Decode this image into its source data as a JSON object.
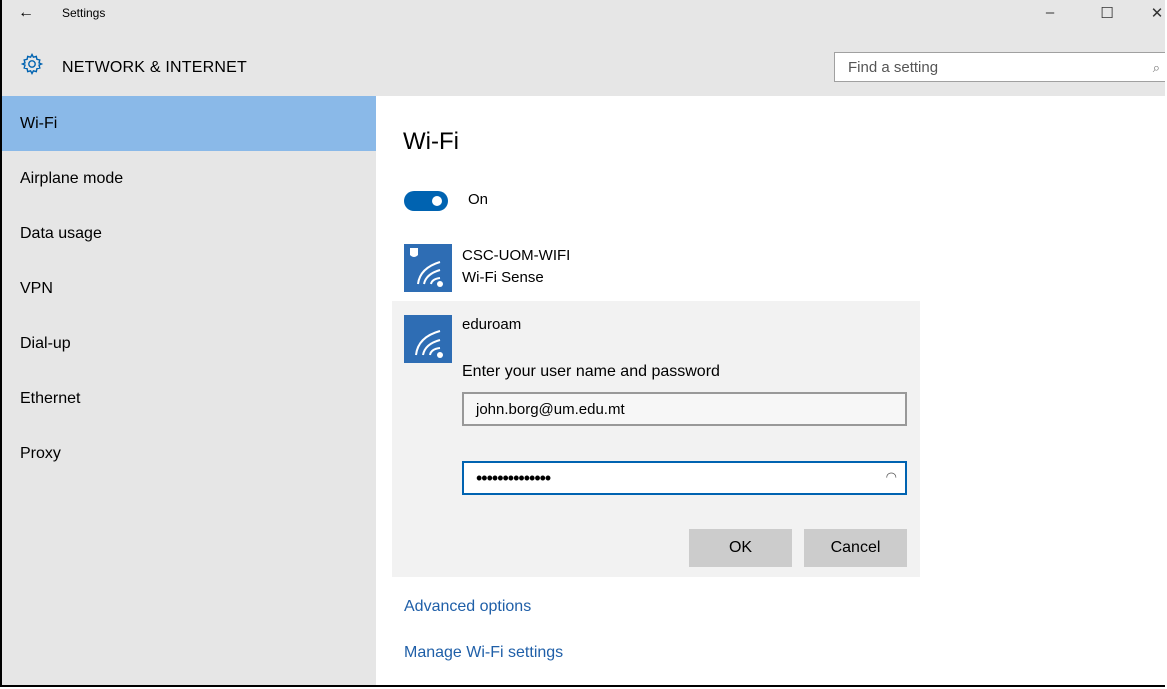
{
  "window": {
    "title": "Settings",
    "back_icon": "back-arrow-icon",
    "minimize": "–",
    "maximize": "☐",
    "close": "✕"
  },
  "header": {
    "title": "NETWORK & INTERNET",
    "icon": "gear-icon"
  },
  "search": {
    "placeholder": "Find a setting",
    "icon": "search-icon"
  },
  "sidebar": {
    "items": [
      {
        "label": "Wi-Fi",
        "selected": true
      },
      {
        "label": "Airplane mode",
        "selected": false
      },
      {
        "label": "Data usage",
        "selected": false
      },
      {
        "label": "VPN",
        "selected": false
      },
      {
        "label": "Dial-up",
        "selected": false
      },
      {
        "label": "Ethernet",
        "selected": false
      },
      {
        "label": "Proxy",
        "selected": false
      }
    ]
  },
  "main": {
    "title": "Wi-Fi",
    "toggle": {
      "state": "On"
    },
    "networks": [
      {
        "name": "CSC-UOM-WIFI",
        "sub": "Wi-Fi Sense",
        "secured": true
      },
      {
        "name": "eduroam",
        "secured": false
      }
    ],
    "login": {
      "prompt": "Enter your user name and password",
      "username": "john.borg@um.edu.mt",
      "password_mask": "••••••••••••••",
      "ok_label": "OK",
      "cancel_label": "Cancel"
    },
    "links": {
      "advanced": "Advanced options",
      "manage": "Manage Wi-Fi settings"
    }
  },
  "colors": {
    "accent": "#0063b1",
    "selected": "#8ab9e8",
    "sidebar": "#e6e6e6",
    "link": "#1f5fa8"
  }
}
